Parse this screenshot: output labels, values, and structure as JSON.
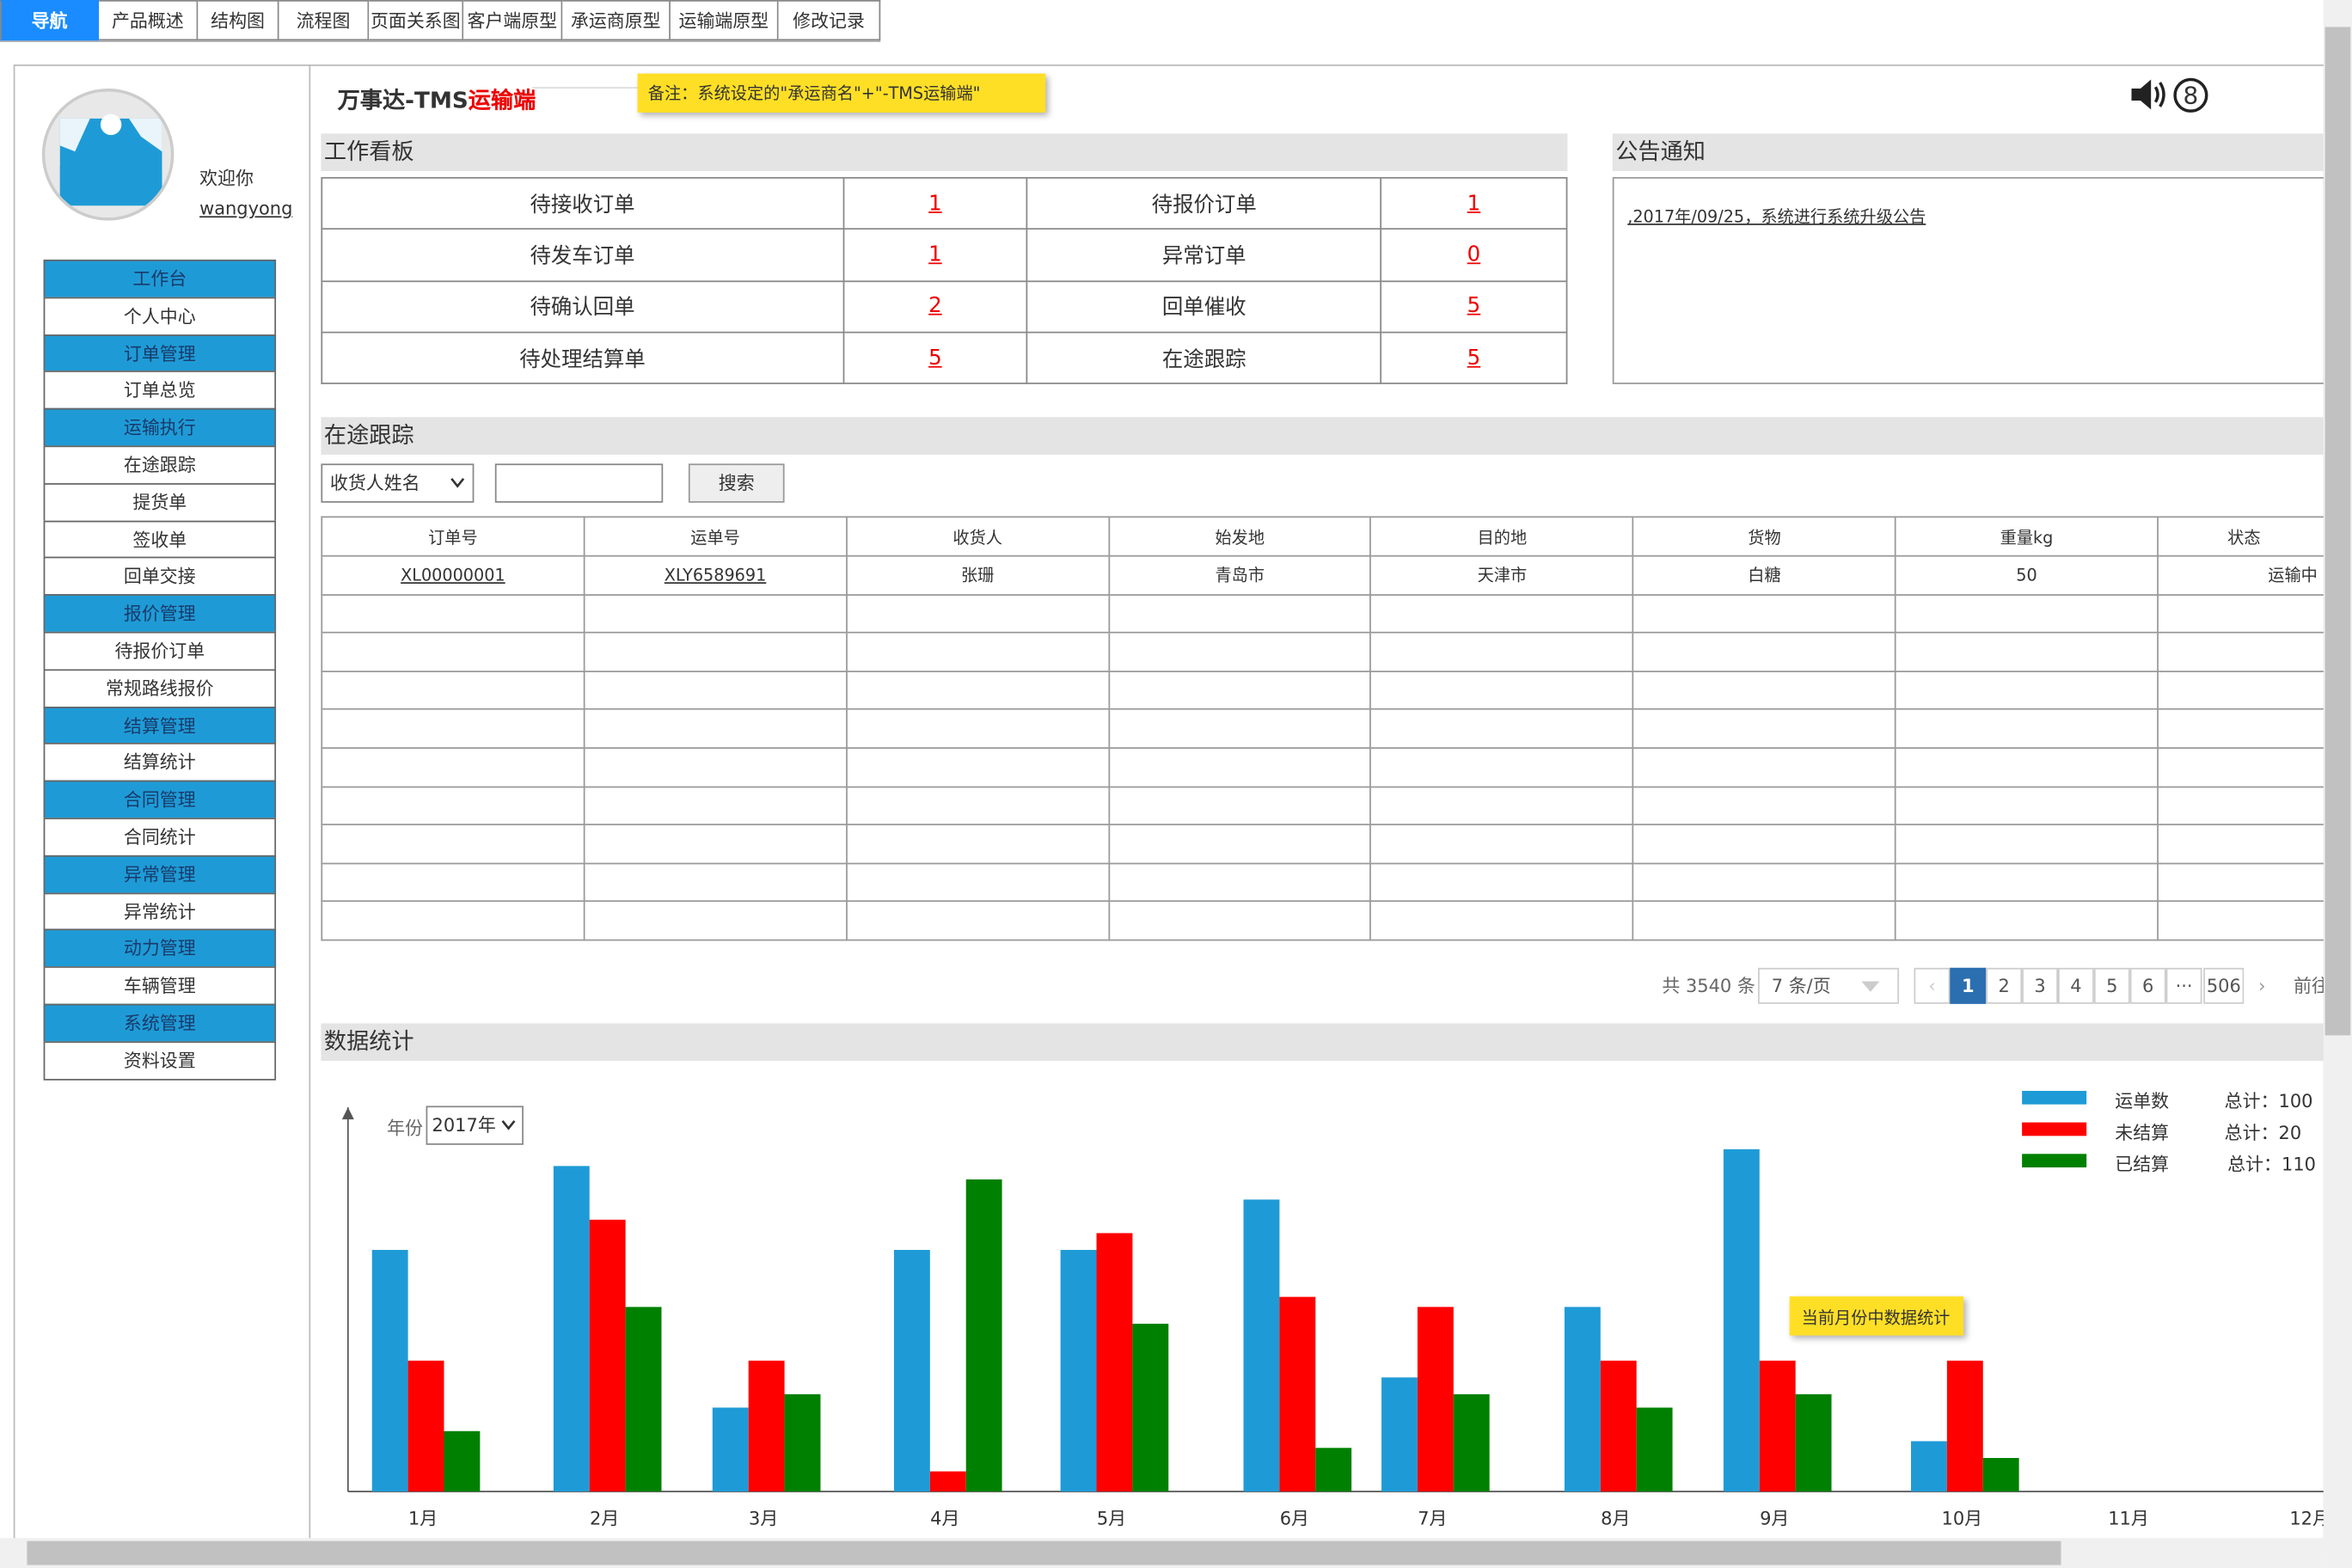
{
  "topnav": [
    "导航",
    "产品概述",
    "结构图",
    "流程图",
    "页面关系图",
    "客户端原型",
    "承运商原型",
    "运输端原型",
    "修改记录"
  ],
  "user": {
    "welcome": "欢迎你",
    "name": "wangyong"
  },
  "menu": [
    {
      "label": "工作台",
      "type": "grp"
    },
    {
      "label": "个人中心",
      "type": "sub"
    },
    {
      "label": "订单管理",
      "type": "grp"
    },
    {
      "label": "订单总览",
      "type": "sub"
    },
    {
      "label": "运输执行",
      "type": "grp"
    },
    {
      "label": "在途跟踪",
      "type": "sub"
    },
    {
      "label": "提货单",
      "type": "sub"
    },
    {
      "label": "签收单",
      "type": "sub"
    },
    {
      "label": "回单交接",
      "type": "sub"
    },
    {
      "label": "报价管理",
      "type": "grp"
    },
    {
      "label": "待报价订单",
      "type": "sub"
    },
    {
      "label": "常规路线报价",
      "type": "sub"
    },
    {
      "label": "结算管理",
      "type": "grp"
    },
    {
      "label": "结算统计",
      "type": "sub"
    },
    {
      "label": "合同管理",
      "type": "grp"
    },
    {
      "label": "合同统计",
      "type": "sub"
    },
    {
      "label": "异常管理",
      "type": "grp"
    },
    {
      "label": "异常统计",
      "type": "sub"
    },
    {
      "label": "动力管理",
      "type": "grp"
    },
    {
      "label": "车辆管理",
      "type": "sub"
    },
    {
      "label": "系统管理",
      "type": "grp"
    },
    {
      "label": "资料设置",
      "type": "sub"
    }
  ],
  "header": {
    "title_prefix": "万事达-TMS",
    "title_suffix": "运输端",
    "note": "备注：系统设定的\"承运商名\"+\"-TMS运输端\"",
    "sound_icon": "speaker-icon",
    "badge": "8"
  },
  "board": {
    "title": "工作看板",
    "rows": [
      [
        "待接收订单",
        "1",
        "待报价订单",
        "1"
      ],
      [
        "待发车订单",
        "1",
        "异常订单",
        "0"
      ],
      [
        "待确认回单",
        "2",
        "回单催收",
        "5"
      ],
      [
        "待处理结算单",
        "5",
        "在途跟踪",
        "5"
      ]
    ]
  },
  "notice": {
    "title": "公告通知",
    "items": [
      ",2017年/09/25，系统进行系统升级公告"
    ]
  },
  "tracking": {
    "title": "在途跟踪",
    "filter_selected": "收货人姓名",
    "search_placeholder": "",
    "search_btn": "搜索",
    "columns": [
      "订单号",
      "运单号",
      "收货人",
      "始发地",
      "目的地",
      "货物",
      "重量kg",
      "状态"
    ],
    "rows": [
      [
        "XL00000001",
        "XLY6589691",
        "张珊",
        "青岛市",
        "天津市",
        "白糖",
        "50",
        "运输中"
      ]
    ],
    "empty_rows": 9,
    "total": "共 3540 条",
    "page_size": "7 条/页",
    "pages": [
      "1",
      "2",
      "3",
      "4",
      "5",
      "6",
      "···",
      "506"
    ],
    "goto": "前往"
  },
  "stats": {
    "title": "数据统计",
    "year_label": "年份",
    "year": "2017年",
    "note": "当前月份中数据统计",
    "legend": [
      {
        "name": "运单数",
        "total": "总计：100",
        "color": "#1e9bd6"
      },
      {
        "name": "未结算",
        "total": "总计：20",
        "color": "#ff0000"
      },
      {
        "name": "已结算",
        "total": "总计：110",
        "color": "#008000"
      }
    ]
  },
  "chart_data": {
    "type": "bar",
    "categories": [
      "1月",
      "2月",
      "3月",
      "4月",
      "5月",
      "6月",
      "7月",
      "8月",
      "9月",
      "10月",
      "11月",
      "12月"
    ],
    "series": [
      {
        "name": "运单数",
        "color": "#1e9bd6",
        "values": [
          72,
          97,
          25,
          72,
          72,
          87,
          34,
          55,
          102,
          15,
          0,
          0
        ]
      },
      {
        "name": "未结算",
        "color": "#ff0000",
        "values": [
          39,
          81,
          39,
          6,
          77,
          58,
          55,
          39,
          39,
          39,
          0,
          0
        ]
      },
      {
        "name": "已结算",
        "color": "#008000",
        "values": [
          18,
          55,
          29,
          93,
          50,
          13,
          29,
          25,
          29,
          10,
          0,
          0
        ]
      }
    ],
    "ylim": [
      0,
      110
    ]
  }
}
